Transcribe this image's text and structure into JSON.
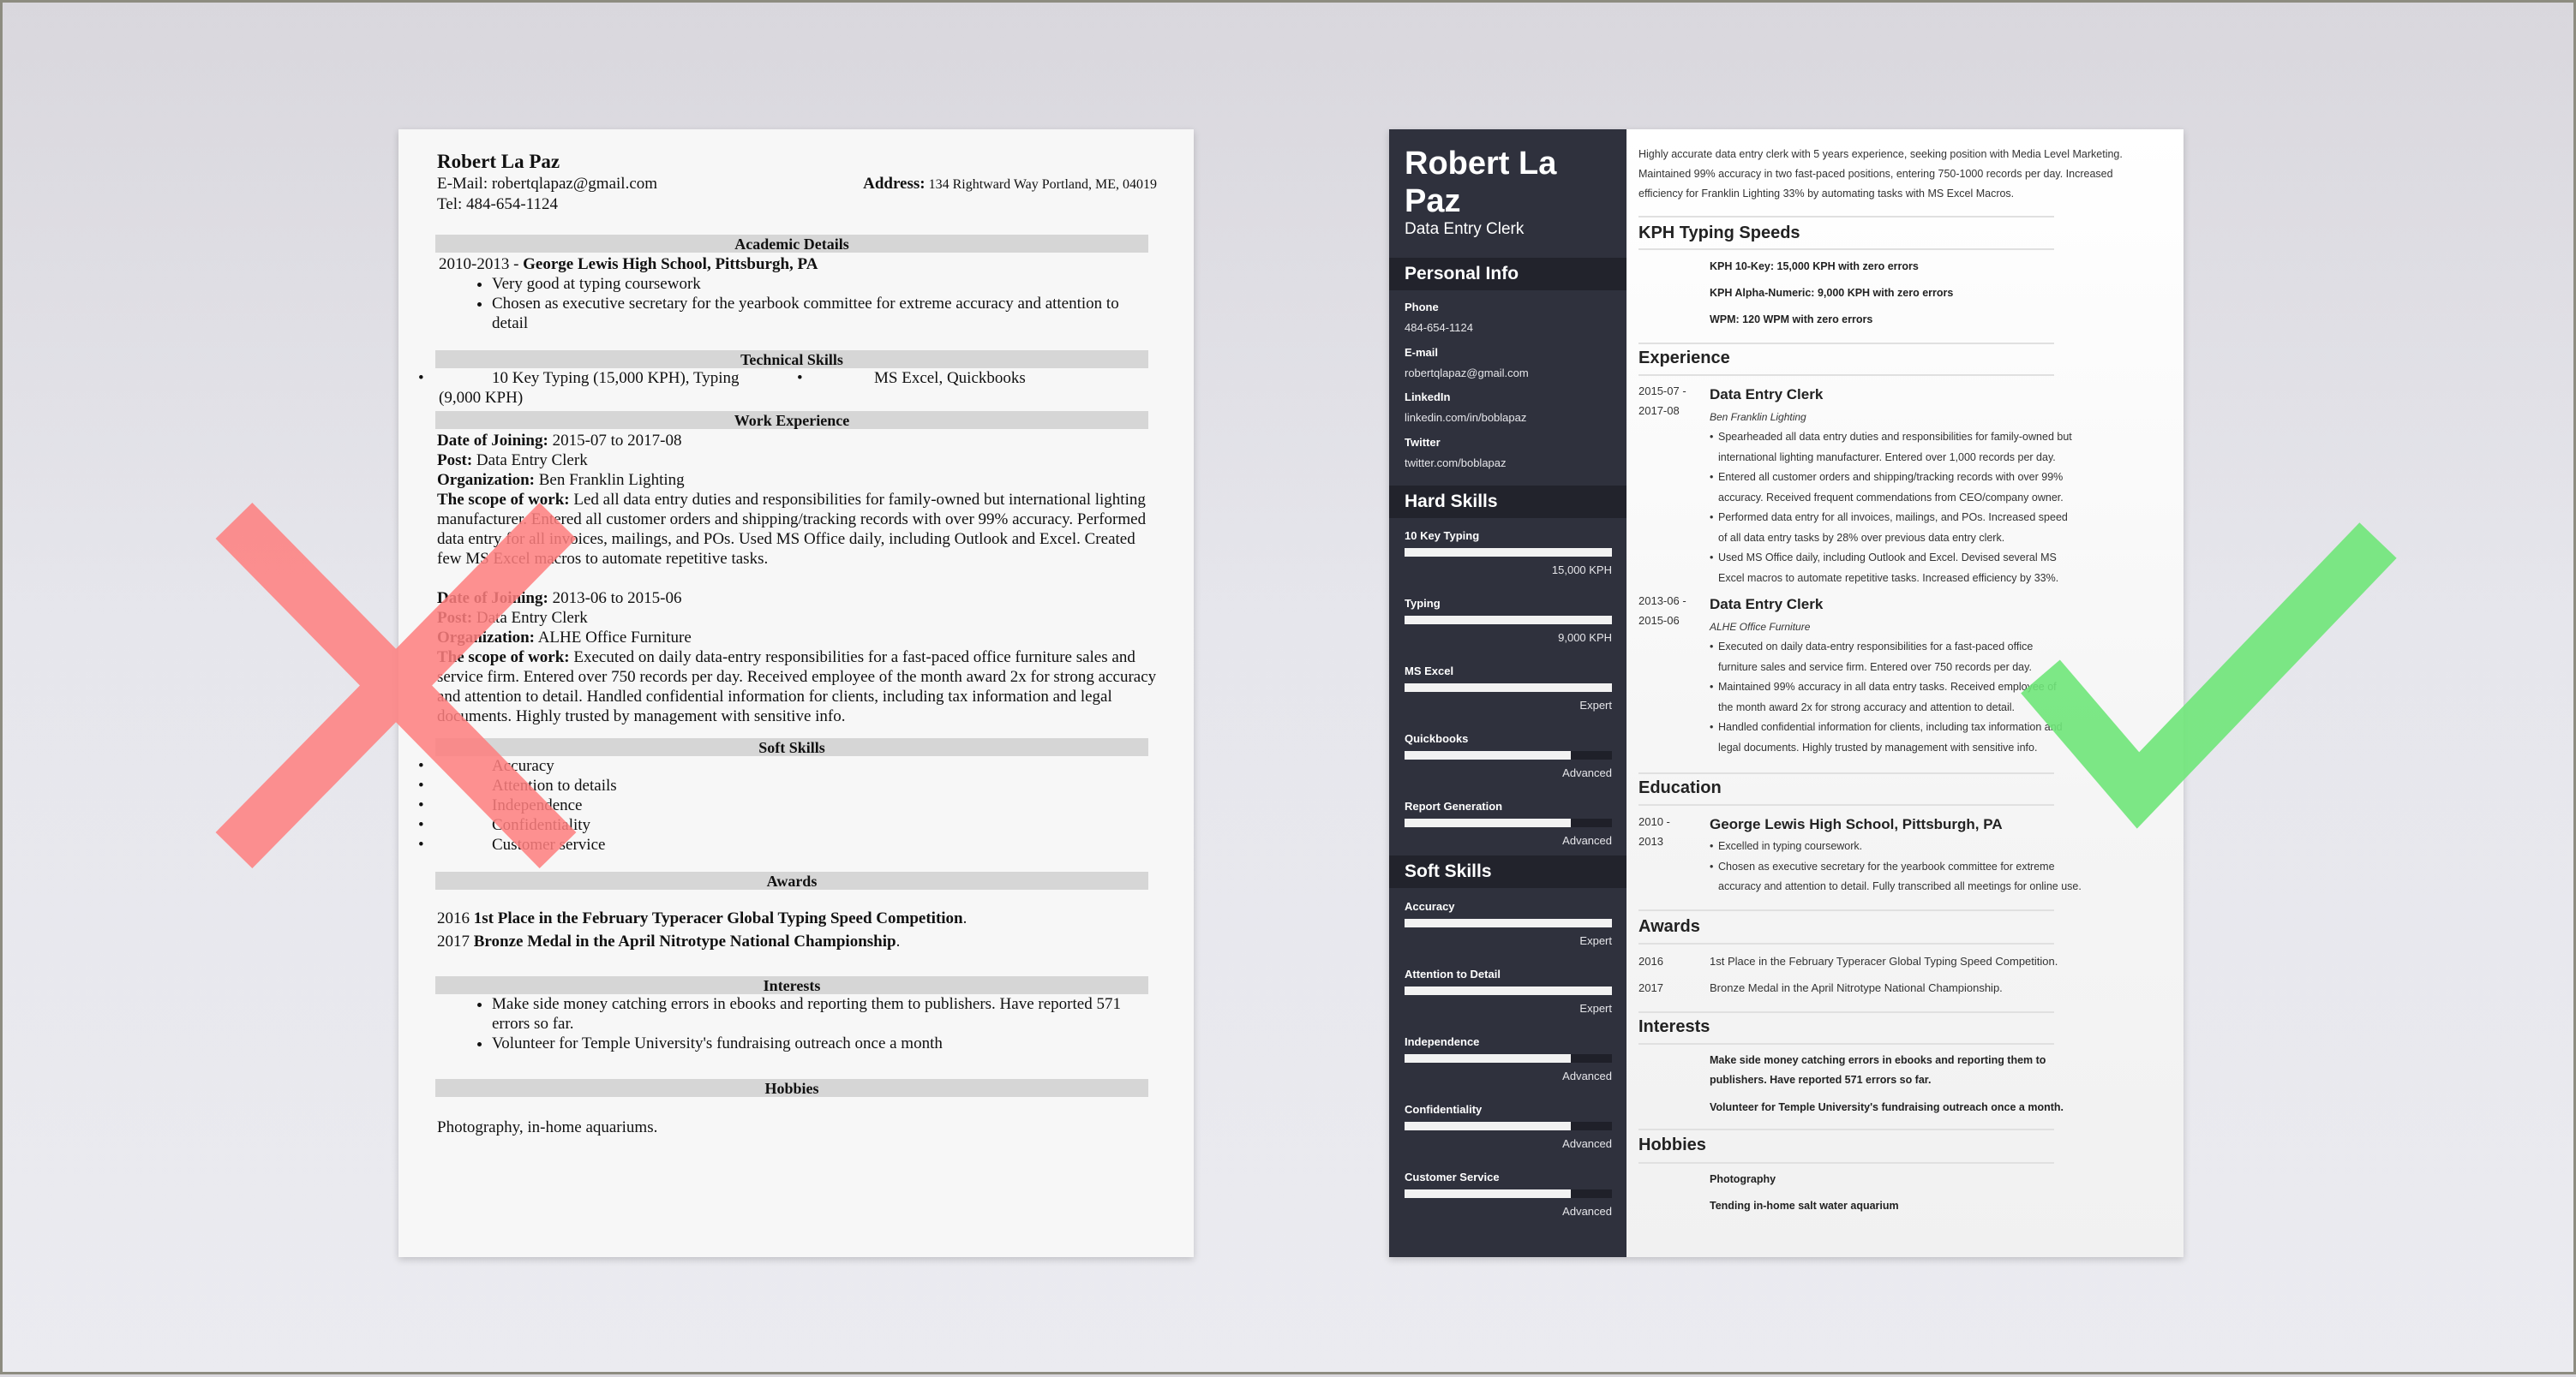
{
  "colors": {
    "x_mark": "#ff7f7f",
    "check_mark": "#6fe579",
    "sidebar_bg": "#2f313d",
    "sidebar_header_bg": "#22232c",
    "section_bar_bg": "#d6d6d6"
  },
  "bad_resume": {
    "name": "Robert La Paz",
    "email_label": "E-Mail:",
    "email": "robertqlapaz@gmail.com",
    "address_label": "Address:",
    "address": "134 Rightward Way Portland, ME, 04019",
    "tel_label": "Tel:",
    "tel": "484-654-1124",
    "sections": {
      "academic": "Academic Details",
      "technical": "Technical Skills",
      "work": "Work Experience",
      "soft": "Soft Skills",
      "awards": "Awards",
      "interests": "Interests",
      "hobbies": "Hobbies"
    },
    "education": {
      "years": "2010-2013 - ",
      "school": "George Lewis High School, Pittsburgh, PA",
      "bullets": [
        "Very good at typing coursework",
        "Chosen as executive secretary for the yearbook committee for extreme accuracy and attention to detail"
      ]
    },
    "technical": {
      "item1_line1": "10 Key Typing (15,000 KPH), Typing",
      "item1_line2": "(9,000 KPH)",
      "item2": "MS Excel, Quickbooks",
      "bullet": "•"
    },
    "jobs": [
      {
        "date_label": "Date of Joining:",
        "dates": "2015-07 to 2017-08",
        "post_label": "Post:",
        "post": "Data Entry Clerk",
        "org_label": "Organization:",
        "org": "Ben Franklin Lighting",
        "scope_label": "The scope of work:",
        "scope": "Led all data entry duties and responsibilities for family-owned but international lighting manufacturer. Entered all customer orders and shipping/tracking records with over 99% accuracy. Performed data entry for all invoices, mailings, and POs. Used MS Office daily, including Outlook and Excel. Created few MS Excel macros to automate repetitive tasks."
      },
      {
        "date_label": "Date of Joining:",
        "dates": "2013-06 to 2015-06",
        "post_label": "Post:",
        "post": "Data Entry Clerk",
        "org_label": "Organization:",
        "org": "ALHE Office Furniture",
        "scope_label": "The scope of work:",
        "scope": "Executed on daily data-entry responsibilities for a fast-paced office furniture sales and service firm. Entered over 750 records per day. Received employee of the month award 2x for strong accuracy and attention to detail. Handled confidential information for clients, including tax information and legal documents. Highly trusted by management with sensitive info."
      }
    ],
    "soft_skills": [
      "Accuracy",
      "Attention to details",
      "Independence",
      "Confidentiality",
      "Customer service"
    ],
    "awards": [
      {
        "year": "2016 ",
        "text": "1st Place in the February Typeracer Global Typing Speed Competition",
        "end": "."
      },
      {
        "year": "2017 ",
        "text": "Bronze Medal in the April Nitrotype National Championship",
        "end": "."
      }
    ],
    "interests": [
      "Make side money catching errors in ebooks and reporting them to publishers. Have reported 571 errors so far.",
      "Volunteer for Temple University's fundraising outreach once a month"
    ],
    "hobbies": "Photography, in-home aquariums."
  },
  "good_resume": {
    "sidebar": {
      "name": "Robert La Paz",
      "title": "Data Entry Clerk",
      "personal_info_heading": "Personal Info",
      "personal_info": [
        {
          "label": "Phone",
          "value": "484-654-1124"
        },
        {
          "label": "E-mail",
          "value": "robertqlapaz@gmail.com"
        },
        {
          "label": "LinkedIn",
          "value": "linkedin.com/in/boblapaz"
        },
        {
          "label": "Twitter",
          "value": "twitter.com/boblapaz"
        }
      ],
      "hard_skills_heading": "Hard Skills",
      "hard_skills": [
        {
          "name": "10 Key Typing",
          "level": "15,000 KPH",
          "fill": 1.0
        },
        {
          "name": "Typing",
          "level": "9,000 KPH",
          "fill": 1.0
        },
        {
          "name": "MS Excel",
          "level": "Expert",
          "fill": 1.0
        },
        {
          "name": "Quickbooks",
          "level": "Advanced",
          "fill": 0.8
        },
        {
          "name": "Report Generation",
          "level": "Advanced",
          "fill": 0.8
        }
      ],
      "soft_skills_heading": "Soft Skills",
      "soft_skills": [
        {
          "name": "Accuracy",
          "level": "Expert",
          "fill": 1.0
        },
        {
          "name": "Attention to Detail",
          "level": "Expert",
          "fill": 1.0
        },
        {
          "name": "Independence",
          "level": "Advanced",
          "fill": 0.8
        },
        {
          "name": "Confidentiality",
          "level": "Advanced",
          "fill": 0.8
        },
        {
          "name": "Customer Service",
          "level": "Advanced",
          "fill": 0.8
        }
      ]
    },
    "main": {
      "summary": "Highly accurate data entry clerk with 5 years experience, seeking position with Media Level Marketing. Maintained 99% accuracy in two fast-paced positions, entering 750-1000 records per day. Increased efficiency for Franklin Lighting 33% by automating tasks with MS Excel Macros.",
      "kph_heading": "KPH Typing Speeds",
      "kph": [
        "KPH 10-Key: 15,000 KPH with zero errors",
        "KPH Alpha-Numeric: 9,000 KPH with zero errors",
        "WPM: 120 WPM with zero errors"
      ],
      "experience_heading": "Experience",
      "jobs": [
        {
          "date_start": "2015-07 -",
          "date_end": "2017-08",
          "role": "Data Entry Clerk",
          "org": "Ben Franklin Lighting",
          "bullets": [
            "Spearheaded all data entry duties and responsibilities for family-owned but international lighting manufacturer. Entered over 1,000 records per day.",
            "Entered all customer orders and shipping/tracking records with over 99% accuracy. Received frequent commendations from CEO/company owner.",
            "Performed data entry for all invoices, mailings, and POs. Increased speed of all data entry tasks by 28% over previous data entry clerk.",
            "Used MS Office daily, including Outlook and Excel. Devised several MS Excel macros to automate repetitive tasks. Increased efficiency by 33%."
          ]
        },
        {
          "date_start": "2013-06 -",
          "date_end": "2015-06",
          "role": "Data Entry Clerk",
          "org": "ALHE Office Furniture",
          "bullets": [
            "Executed on daily data-entry responsibilities for a fast-paced office furniture sales and service firm. Entered over 750 records per day.",
            "Maintained 99% accuracy in all data entry tasks. Received employee of the month award 2x for strong accuracy and attention to detail.",
            "Handled confidential information for clients, including tax information and legal documents. Highly trusted by management with sensitive info."
          ]
        }
      ],
      "education_heading": "Education",
      "education": {
        "date_start": "2010 -",
        "date_end": "2013",
        "school": "George Lewis High School, Pittsburgh, PA",
        "bullets": [
          "Excelled in typing coursework.",
          "Chosen as executive secretary for the yearbook committee for extreme accuracy and attention to detail. Fully transcribed all meetings for online use."
        ]
      },
      "awards_heading": "Awards",
      "awards": [
        {
          "year": "2016",
          "text": "1st Place in the February Typeracer Global Typing Speed Competition."
        },
        {
          "year": "2017",
          "text": "Bronze Medal in the April Nitrotype National Championship."
        }
      ],
      "interests_heading": "Interests",
      "interests": [
        "Make side money catching errors in ebooks and reporting them to publishers. Have reported 571 errors so far.",
        "Volunteer for Temple University's fundraising outreach once a month."
      ],
      "hobbies_heading": "Hobbies",
      "hobbies": [
        "Photography",
        "Tending in-home salt water aquarium"
      ]
    }
  }
}
